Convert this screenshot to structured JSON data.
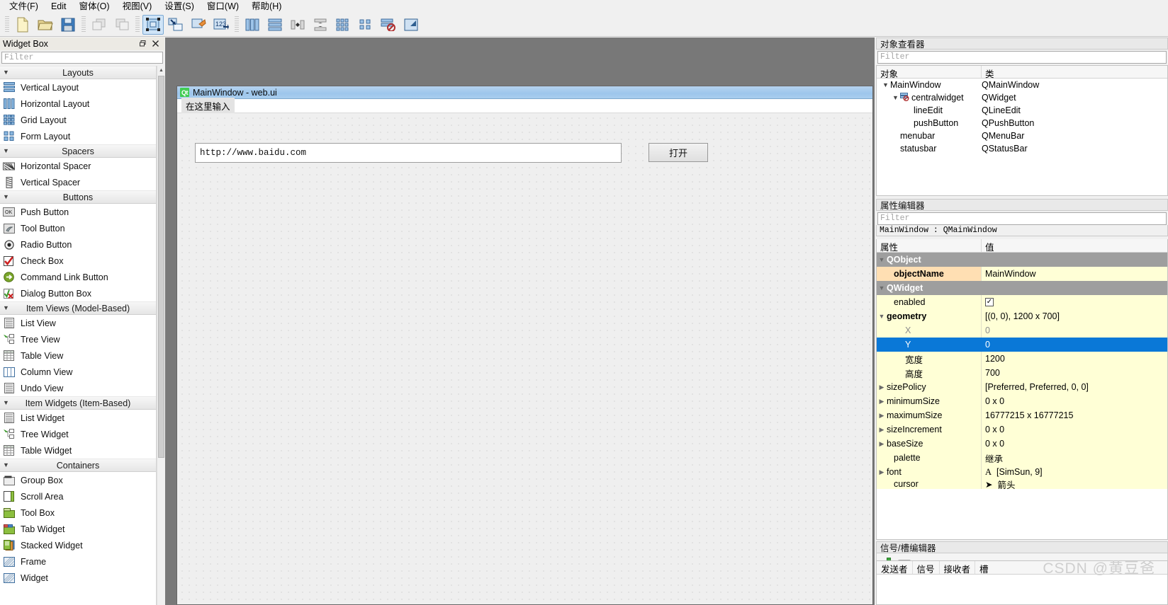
{
  "menubar": {
    "items": [
      {
        "label": "文件(F)",
        "mnemonic": "F"
      },
      {
        "label": "Edit",
        "mnemonic": "E"
      },
      {
        "label": "窗体(O)",
        "mnemonic": "O"
      },
      {
        "label": "视图(V)",
        "mnemonic": "V"
      },
      {
        "label": "设置(S)",
        "mnemonic": "S"
      },
      {
        "label": "窗口(W)",
        "mnemonic": "W"
      },
      {
        "label": "帮助(H)",
        "mnemonic": "H"
      }
    ]
  },
  "toolbar": {
    "groups": [
      [
        "new-file-icon",
        "open-folder-icon",
        "save-icon"
      ],
      [
        "undo-icon",
        "redo-icon"
      ],
      [
        "edit-widgets-icon",
        "edit-signals-slots-icon",
        "edit-buddies-icon",
        "edit-tab-order-icon"
      ],
      [
        "layout-horizontally-icon",
        "layout-vertically-icon",
        "layout-splitter-h-icon",
        "layout-splitter-v-icon",
        "layout-grid-icon",
        "layout-form-icon",
        "break-layout-icon",
        "adjust-size-icon"
      ]
    ],
    "active_tool": "edit-widgets-icon"
  },
  "widget_box": {
    "title": "Widget Box",
    "filter_placeholder": "Filter",
    "restore_icon": "restore-icon",
    "close_icon": "close-icon",
    "groups": [
      {
        "name": "Layouts",
        "expanded": true,
        "items": [
          {
            "label": "Vertical Layout",
            "icon": "vertical-layout-icon"
          },
          {
            "label": "Horizontal Layout",
            "icon": "horizontal-layout-icon"
          },
          {
            "label": "Grid Layout",
            "icon": "grid-layout-icon"
          },
          {
            "label": "Form Layout",
            "icon": "form-layout-icon"
          }
        ]
      },
      {
        "name": "Spacers",
        "expanded": true,
        "items": [
          {
            "label": "Horizontal Spacer",
            "icon": "horizontal-spacer-icon"
          },
          {
            "label": "Vertical Spacer",
            "icon": "vertical-spacer-icon"
          }
        ]
      },
      {
        "name": "Buttons",
        "expanded": true,
        "items": [
          {
            "label": "Push Button",
            "icon": "push-button-icon"
          },
          {
            "label": "Tool Button",
            "icon": "tool-button-icon"
          },
          {
            "label": "Radio Button",
            "icon": "radio-button-icon"
          },
          {
            "label": "Check Box",
            "icon": "check-box-icon"
          },
          {
            "label": "Command Link Button",
            "icon": "command-link-button-icon"
          },
          {
            "label": "Dialog Button Box",
            "icon": "dialog-button-box-icon"
          }
        ]
      },
      {
        "name": "Item Views (Model-Based)",
        "expanded": true,
        "items": [
          {
            "label": "List View",
            "icon": "list-view-icon"
          },
          {
            "label": "Tree View",
            "icon": "tree-view-icon"
          },
          {
            "label": "Table View",
            "icon": "table-view-icon"
          },
          {
            "label": "Column View",
            "icon": "column-view-icon"
          },
          {
            "label": "Undo View",
            "icon": "undo-view-icon"
          }
        ]
      },
      {
        "name": "Item Widgets (Item-Based)",
        "expanded": true,
        "items": [
          {
            "label": "List Widget",
            "icon": "list-widget-icon"
          },
          {
            "label": "Tree Widget",
            "icon": "tree-widget-icon"
          },
          {
            "label": "Table Widget",
            "icon": "table-widget-icon"
          }
        ]
      },
      {
        "name": "Containers",
        "expanded": true,
        "items": [
          {
            "label": "Group Box",
            "icon": "group-box-icon"
          },
          {
            "label": "Scroll Area",
            "icon": "scroll-area-icon"
          },
          {
            "label": "Tool Box",
            "icon": "tool-box-icon"
          },
          {
            "label": "Tab Widget",
            "icon": "tab-widget-icon"
          },
          {
            "label": "Stacked Widget",
            "icon": "stacked-widget-icon"
          },
          {
            "label": "Frame",
            "icon": "frame-icon"
          },
          {
            "label": "Widget",
            "icon": "widget-icon"
          }
        ]
      }
    ]
  },
  "form": {
    "title": "MainWindow - web.ui",
    "app_icon": "qt-logo-icon",
    "menubar_placeholder": "在这里输入",
    "line_edit_value": "http://www.baidu.com",
    "push_button_label": "打开"
  },
  "object_inspector": {
    "title": "对象查看器",
    "filter_placeholder": "Filter",
    "columns": [
      "对象",
      "类"
    ],
    "rows": [
      {
        "object": "MainWindow",
        "class": "QMainWindow",
        "depth": 0,
        "expanded": true,
        "icon": null,
        "selected": false
      },
      {
        "object": "centralwidget",
        "class": "QWidget",
        "depth": 1,
        "expanded": true,
        "icon": "break-layout-icon",
        "selected": false
      },
      {
        "object": "lineEdit",
        "class": "QLineEdit",
        "depth": 2,
        "expanded": null,
        "icon": null,
        "selected": false
      },
      {
        "object": "pushButton",
        "class": "QPushButton",
        "depth": 2,
        "expanded": null,
        "icon": null,
        "selected": false
      },
      {
        "object": "menubar",
        "class": "QMenuBar",
        "depth": 1,
        "expanded": null,
        "icon": null,
        "selected": false
      },
      {
        "object": "statusbar",
        "class": "QStatusBar",
        "depth": 1,
        "expanded": null,
        "icon": null,
        "selected": false
      }
    ]
  },
  "property_editor": {
    "title": "属性编辑器",
    "filter_placeholder": "Filter",
    "object_class_line": "MainWindow : QMainWindow",
    "columns": [
      "属性",
      "值"
    ],
    "rows": [
      {
        "name": "QObject",
        "value": "",
        "kind": "group",
        "depth": 0,
        "expanded": true
      },
      {
        "name": "objectName",
        "value": "MainWindow",
        "kind": "orange",
        "depth": 1
      },
      {
        "name": "QWidget",
        "value": "",
        "kind": "group",
        "depth": 0,
        "expanded": true
      },
      {
        "name": "enabled",
        "value": "checkbox-checked",
        "kind": "yellow",
        "depth": 1
      },
      {
        "name": "geometry",
        "value": "[(0, 0), 1200 x 700]",
        "kind": "yellow-bold",
        "depth": 1,
        "expanded": true
      },
      {
        "name": "X",
        "value": "0",
        "kind": "yellow-grey",
        "depth": 2
      },
      {
        "name": "Y",
        "value": "0",
        "kind": "selected",
        "depth": 2
      },
      {
        "name": "宽度",
        "value": "1200",
        "kind": "yellow",
        "depth": 2
      },
      {
        "name": "高度",
        "value": "700",
        "kind": "yellow",
        "depth": 2
      },
      {
        "name": "sizePolicy",
        "value": "[Preferred, Preferred, 0, 0]",
        "kind": "yellow-collapsed",
        "depth": 1
      },
      {
        "name": "minimumSize",
        "value": "0 x 0",
        "kind": "yellow-collapsed",
        "depth": 1
      },
      {
        "name": "maximumSize",
        "value": "16777215 x 16777215",
        "kind": "yellow-collapsed",
        "depth": 1
      },
      {
        "name": "sizeIncrement",
        "value": "0 x 0",
        "kind": "yellow-collapsed",
        "depth": 1
      },
      {
        "name": "baseSize",
        "value": "0 x 0",
        "kind": "yellow-collapsed",
        "depth": 1
      },
      {
        "name": "palette",
        "value": "继承",
        "kind": "yellow",
        "depth": 1
      },
      {
        "name": "font",
        "value": "[SimSun, 9]",
        "kind": "yellow-collapsed-font",
        "depth": 1
      },
      {
        "name": "cursor",
        "value": "箭头",
        "kind": "yellow-cursor",
        "depth": 1
      }
    ]
  },
  "signal_slot_editor": {
    "title": "信号/槽编辑器",
    "add_icon": "plus-icon",
    "remove_icon": "minus-icon",
    "columns": [
      "发送者",
      "信号",
      "接收者",
      "槽"
    ],
    "rows": []
  },
  "watermark": "CSDN @黄豆爸",
  "colors": {
    "accent": "#0a78d7",
    "title_gradient_start": "#b5d3ef",
    "property_yellow": "#ffffd6",
    "property_orange": "#ffdfb3",
    "group_grey": "#9e9e9e",
    "canvas_grey": "#787878"
  }
}
